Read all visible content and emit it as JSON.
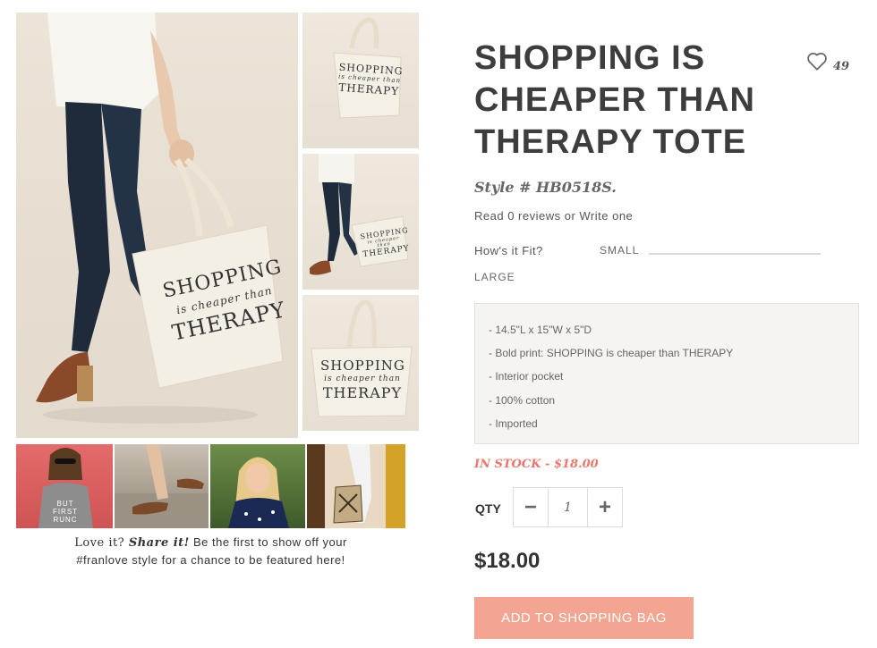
{
  "product": {
    "title": "SHOPPING IS CHEAPER THAN THERAPY TOTE",
    "style": "Style # HB0518S.",
    "reviews_text": "Read 0 reviews or Write one",
    "favorites_count": "49"
  },
  "tote_print": {
    "line1": "SHOPPING",
    "line2": "is cheaper than",
    "line3": "THERAPY"
  },
  "ugc_shirt_text": "BUT FIRST RUNC",
  "fit": {
    "label": "How's it Fit?",
    "small": "SMALL",
    "large": "LARGE"
  },
  "description": [
    "- 14.5\"L x 15\"W x  5\"D",
    "- Bold print: SHOPPING is cheaper than THERAPY",
    "- Interior pocket",
    "- 100% cotton",
    "- Imported"
  ],
  "stock": "IN STOCK - $18.00",
  "qty": {
    "label": "QTY",
    "value": "1",
    "minus": "−",
    "plus": "+"
  },
  "price": "$18.00",
  "add_button": "ADD TO SHOPPING BAG",
  "promo": {
    "prefix": "Love it? ",
    "share": "Share it!",
    "line1_rest": " Be the first to show off your",
    "line2": "#franlove style for a chance to be featured here!"
  },
  "colors": {
    "accent": "#f3a591",
    "stock": "#e9776a",
    "title": "#3d3d3d"
  },
  "icons": {
    "favorite": "heart-outline-icon",
    "minus": "minus-icon",
    "plus": "plus-icon"
  }
}
